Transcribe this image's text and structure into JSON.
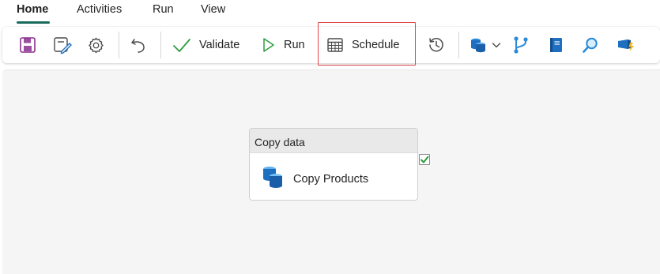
{
  "tabs": [
    {
      "label": "Home",
      "active": true
    },
    {
      "label": "Activities",
      "active": false
    },
    {
      "label": "Run",
      "active": false
    },
    {
      "label": "View",
      "active": false
    }
  ],
  "toolbar": {
    "validate_label": "Validate",
    "run_label": "Run",
    "schedule_label": "Schedule"
  },
  "canvas": {
    "node": {
      "header": "Copy data",
      "label": "Copy Products",
      "success": true
    }
  },
  "colors": {
    "accent": "#1a6a5c",
    "save_icon": "#8a2f8f",
    "validate_check": "#2e9b3f",
    "highlight_box": "#e0474c",
    "db_blue": "#1f6fc0",
    "canvas_bg": "#f5f5f5"
  },
  "icons": [
    "save-icon",
    "save-as-icon",
    "settings-gear-icon",
    "undo-icon",
    "checkmark-icon",
    "play-icon",
    "calendar-icon",
    "history-icon",
    "database-icon",
    "chevron-down-icon",
    "branch-icon",
    "notebook-icon",
    "search-icon",
    "dataflow-icon"
  ]
}
